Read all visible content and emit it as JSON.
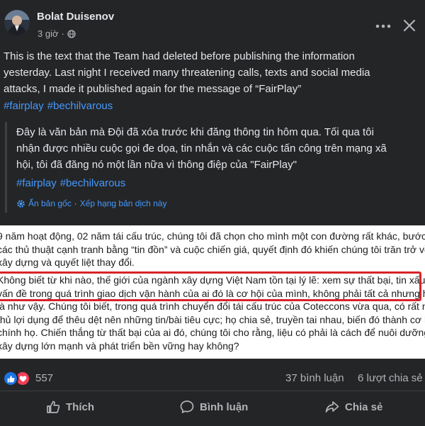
{
  "post": {
    "author": "Bolat Duisenov",
    "time": "3 giờ",
    "privacy_icon": "public-globe-icon",
    "text_lines": [
      "This is the text that the Team had deleted before publishing the information",
      "yesterday. Last night I received many threatening calls, texts and social media",
      "attacks, I made it published again for the message of “FairPlay”"
    ],
    "hashtags": [
      "#fairplay",
      "#bechilvarous"
    ]
  },
  "translation": {
    "text_lines": [
      "Đây là văn bản mà Đội đã xóa trước khi đăng thông tin hôm qua. Tối qua tôi",
      "nhận được nhiều cuộc gọi đe dọa, tin nhắn và các cuộc tấn công trên mạng xã",
      "hội, tôi đã đăng nó một lần nữa vì thông điệp của \"FairPlay\""
    ],
    "hashtags": [
      "#fairplay",
      "#bechilvarous"
    ],
    "hide_original": "Ẩn bản gốc",
    "separator": "·",
    "rate_translation": "Xếp hạng bản dịch này"
  },
  "article": {
    "para1": [
      "9 năm hoạt động, 02 năm tái cấu trúc, chúng tôi đã chọn cho mình một con đường rất khác, bước ra khỏi",
      "các thủ thuật cạnh tranh bằng “tin đồn” và cuộc chiến giá, quyết định đó khiến chúng tôi trăn trở về ngành",
      "xây dựng và quyết liệt thay đổi."
    ],
    "para2": [
      "Không biết từ khi nào, thế giới của ngành xây dựng Việt Nam tồn tại lý lẽ: xem sự thất bại, tin xấu, những",
      "vấn đề trong quá trình giao dịch vận hành của ai đó là cơ hội của mình, không phải tất cả nhưng hầu hết",
      "là như vậy. Chúng tôi biết, trong quá trình chuyển đổi tái cấu trúc của Coteccons vừa qua, có rất nhiều đối",
      "thủ lợi dụng để thêu dệt nên những tin/bài tiêu cực; họ chia sẻ, truyền tai nhau, biến đó thành cơ hội của",
      "chính họ. Chiến thắng từ thất bại của ai đó, chúng tôi cho rằng, liệu có phải là cách để nuôi dưỡng ngành",
      "xây dựng lớn mạnh và phát triển bền vững hay không?"
    ]
  },
  "engagement": {
    "reaction_count": "557",
    "comments": "37 bình luận",
    "shares": "6 lượt chia sẻ"
  },
  "actions": {
    "like": "Thích",
    "comment": "Bình luận",
    "share": "Chia sẻ"
  },
  "colors": {
    "background": "#242526",
    "link": "#4599ff",
    "text": "#e4e6eb",
    "muted": "#b0b3b8",
    "highlight_border": "#d8232a"
  }
}
